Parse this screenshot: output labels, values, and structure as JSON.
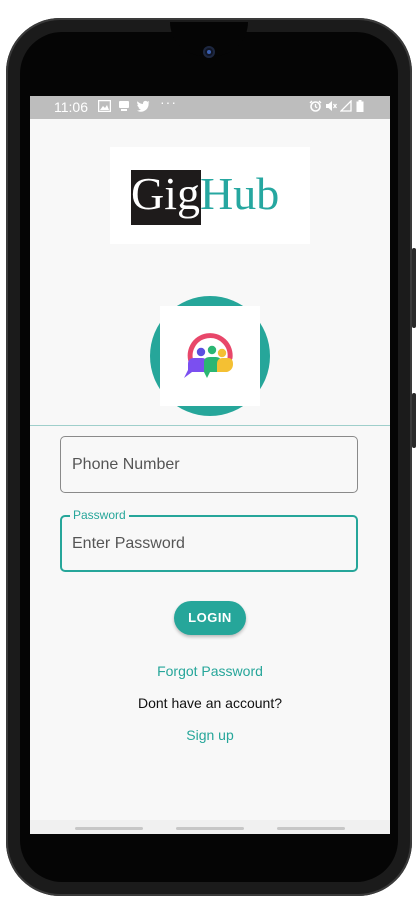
{
  "status_bar": {
    "time": "11:06",
    "left_icons": [
      "image-icon",
      "notification-icon",
      "twitter-icon",
      "more-dots-icon"
    ],
    "right_icons": [
      "alarm-icon",
      "mute-icon",
      "signal-icon",
      "battery-icon"
    ]
  },
  "logo": {
    "part1": "Gig",
    "part2": "Hub"
  },
  "phone_field": {
    "placeholder": "Phone Number"
  },
  "password_field": {
    "label": "Password",
    "placeholder": "Enter Password"
  },
  "login_button": "LOGIN",
  "forgot_password": "Forgot Password",
  "no_account": "Dont have an account?",
  "sign_up": "Sign up",
  "colors": {
    "accent": "#26a69a",
    "status_bar": "#bdbdbd",
    "background": "#f8f8f8"
  }
}
